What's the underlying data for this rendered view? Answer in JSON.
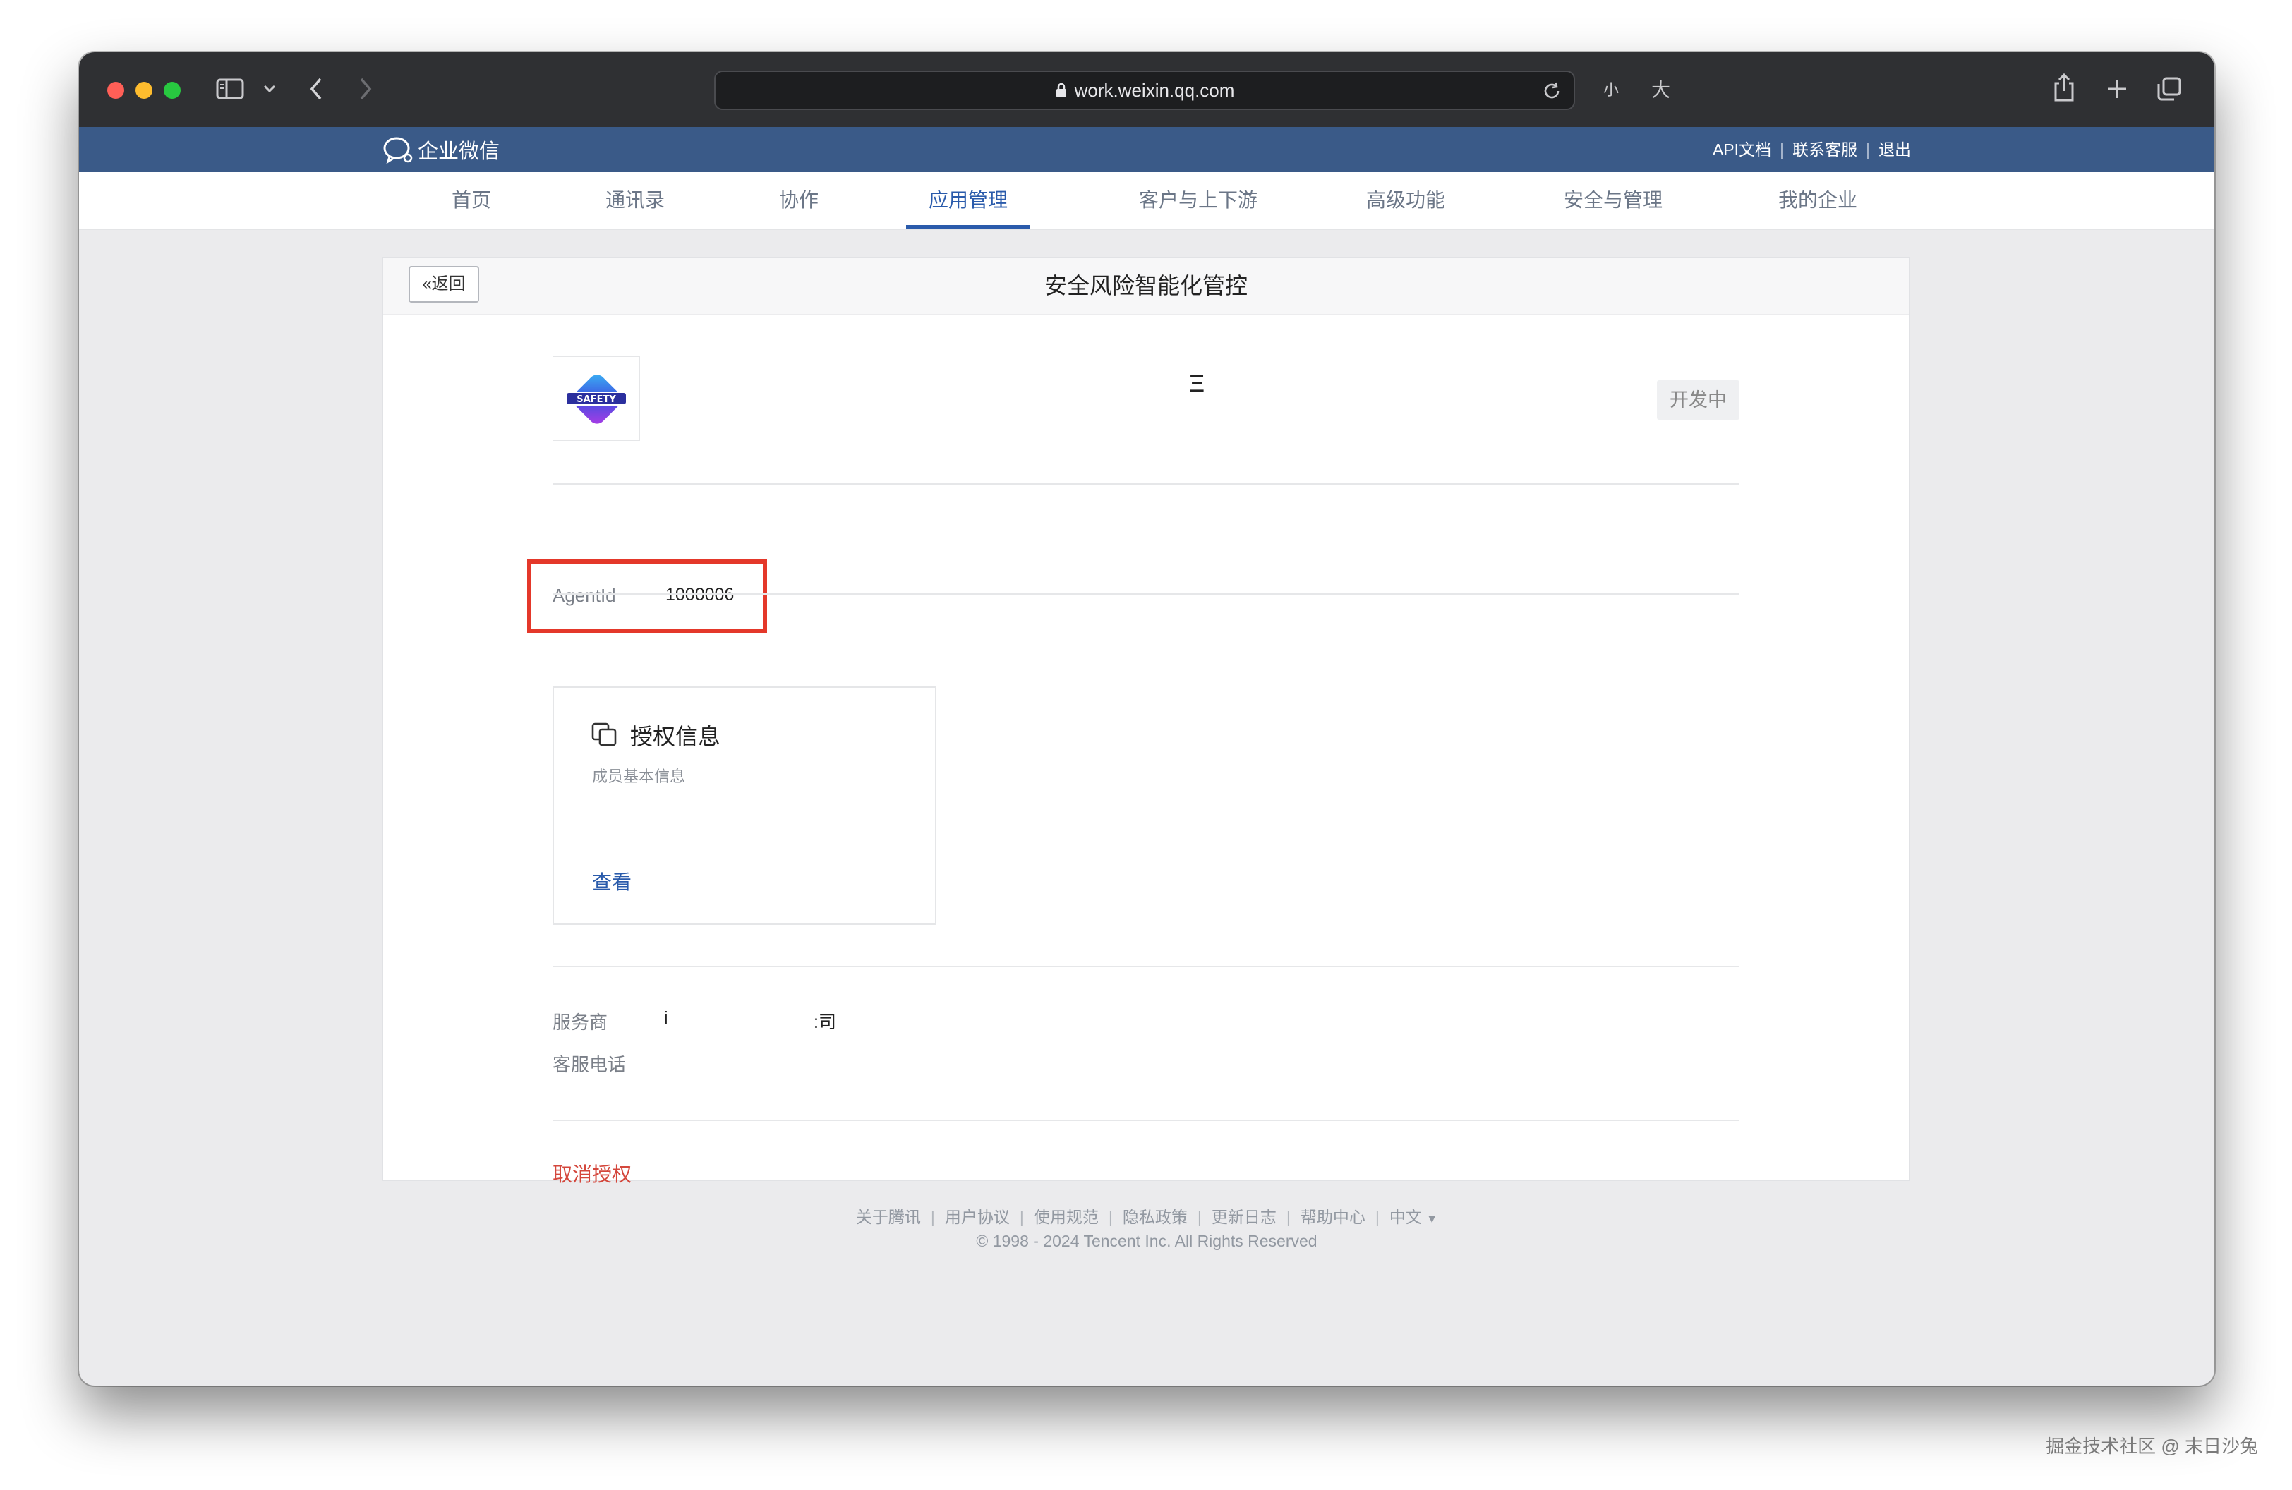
{
  "browser": {
    "url": "work.weixin.qq.com",
    "text_small": "小",
    "text_large": "大",
    "icons": [
      "sidebar-icon",
      "chevron-down-icon",
      "back-arrow-icon",
      "forward-arrow-icon",
      "lock-icon",
      "reload-icon",
      "share-icon",
      "plus-icon",
      "tabs-icon"
    ]
  },
  "header": {
    "brand": "企业微信",
    "links": [
      "API文档",
      "联系客服",
      "退出"
    ]
  },
  "nav": {
    "items": [
      "首页",
      "通讯录",
      "协作",
      "应用管理",
      "客户与上下游",
      "高级功能",
      "安全与管理",
      "我的企业"
    ],
    "active": "应用管理",
    "active_color": "#2a5bab"
  },
  "page": {
    "back_label": "返回",
    "title": "安全风险智能化管控",
    "app_name_fragment": "Ξ",
    "status": "开发中",
    "logo_text": "SAFETY",
    "agent_label": "AgentId",
    "agent_id": "1000006",
    "permission": {
      "title": "授权信息",
      "subtitle": "成员基本信息",
      "link": "查看"
    },
    "provider_label": "服务商",
    "provider_fragment_a": "i",
    "provider_fragment_b": ":司",
    "phone_label": "客服电话",
    "cancel_label": "取消授权"
  },
  "footer": {
    "links": [
      "关于腾讯",
      "用户协议",
      "使用规范",
      "隐私政策",
      "更新日志",
      "帮助中心",
      "中文"
    ],
    "copyright": "© 1998 - 2024 Tencent Inc. All Rights Reserved"
  },
  "watermark": "掘金技术社区 @ 末日沙兔"
}
